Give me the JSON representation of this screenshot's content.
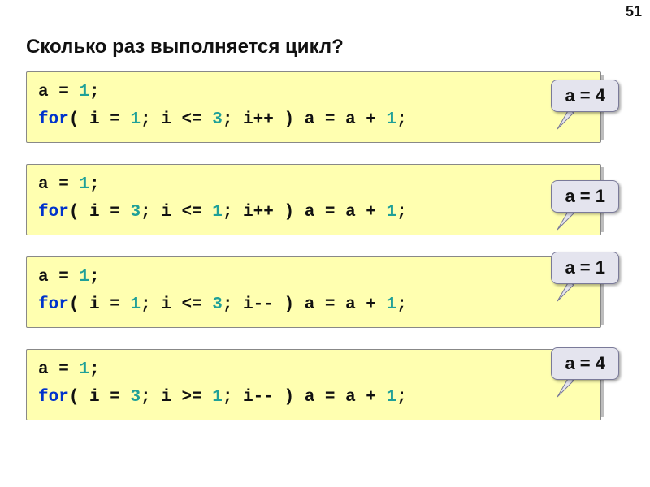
{
  "page_number": "51",
  "title": "Сколько раз выполняется цикл?",
  "examples": [
    {
      "l1": {
        "a": "a = ",
        "b": "1",
        "c": ";"
      },
      "l2": {
        "kw": "for",
        "a": "( i = ",
        "n1": "1",
        "b": "; i <= ",
        "n2": "3",
        "c": "; i++ ) a = a + ",
        "n3": "1",
        "d": ";"
      },
      "answer": "a = 4"
    },
    {
      "l1": {
        "a": "a = ",
        "b": "1",
        "c": ";"
      },
      "l2": {
        "kw": "for",
        "a": "( i = ",
        "n1": "3",
        "b": "; i <= ",
        "n2": "1",
        "c": "; i++ ) a = a + ",
        "n3": "1",
        "d": ";"
      },
      "answer": "a = 1"
    },
    {
      "l1": {
        "a": "a = ",
        "b": "1",
        "c": ";"
      },
      "l2": {
        "kw": "for",
        "a": "( i = ",
        "n1": "1",
        "b": "; i <= ",
        "n2": "3",
        "c": "; i-- ) a = a + ",
        "n3": "1",
        "d": ";"
      },
      "answer": "a = 1"
    },
    {
      "l1": {
        "a": "a = ",
        "b": "1",
        "c": ";"
      },
      "l2": {
        "kw": "for",
        "a": "( i = ",
        "n1": "3",
        "b": "; i >= ",
        "n2": "1",
        "c": "; i-- ) a = a + ",
        "n3": "1",
        "d": ";"
      },
      "answer": "a = 4"
    }
  ]
}
